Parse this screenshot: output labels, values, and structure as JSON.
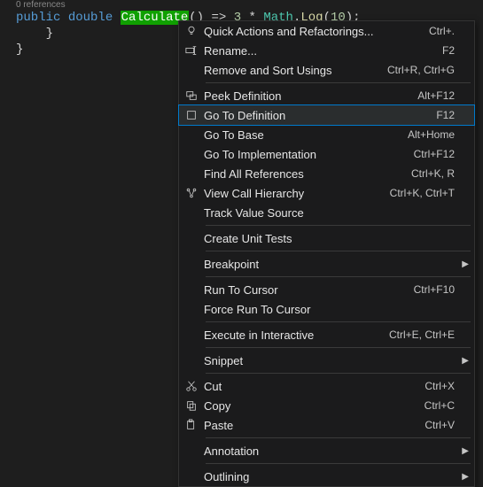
{
  "editor": {
    "codelens": "0 references",
    "tokens": {
      "public": "public",
      "double": "double",
      "method": "Calculate",
      "parens": "()",
      "arrow": " => ",
      "num": "3",
      "star": " * ",
      "class": "Math",
      "dot": ".",
      "member": "Log",
      "open": "(",
      "arg": "10",
      "close": ");"
    },
    "brace1": "    }",
    "brace2": "}"
  },
  "menu": {
    "quick_actions": {
      "label": "Quick Actions and Refactorings...",
      "shortcut": "Ctrl+."
    },
    "rename": {
      "label": "Rename...",
      "shortcut": "F2"
    },
    "remove_usings": {
      "label": "Remove and Sort Usings",
      "shortcut": "Ctrl+R, Ctrl+G"
    },
    "peek_def": {
      "label": "Peek Definition",
      "shortcut": "Alt+F12"
    },
    "goto_def": {
      "label": "Go To Definition",
      "shortcut": "F12"
    },
    "goto_base": {
      "label": "Go To Base",
      "shortcut": "Alt+Home"
    },
    "goto_impl": {
      "label": "Go To Implementation",
      "shortcut": "Ctrl+F12"
    },
    "find_refs": {
      "label": "Find All References",
      "shortcut": "Ctrl+K, R"
    },
    "call_hier": {
      "label": "View Call Hierarchy",
      "shortcut": "Ctrl+K, Ctrl+T"
    },
    "track_value": {
      "label": "Track Value Source",
      "shortcut": ""
    },
    "create_tests": {
      "label": "Create Unit Tests",
      "shortcut": ""
    },
    "breakpoint": {
      "label": "Breakpoint",
      "shortcut": ""
    },
    "run_cursor": {
      "label": "Run To Cursor",
      "shortcut": "Ctrl+F10"
    },
    "force_run": {
      "label": "Force Run To Cursor",
      "shortcut": ""
    },
    "exec_inter": {
      "label": "Execute in Interactive",
      "shortcut": "Ctrl+E, Ctrl+E"
    },
    "snippet": {
      "label": "Snippet",
      "shortcut": ""
    },
    "cut": {
      "label": "Cut",
      "shortcut": "Ctrl+X"
    },
    "copy": {
      "label": "Copy",
      "shortcut": "Ctrl+C"
    },
    "paste": {
      "label": "Paste",
      "shortcut": "Ctrl+V"
    },
    "annotation": {
      "label": "Annotation",
      "shortcut": ""
    },
    "outlining": {
      "label": "Outlining",
      "shortcut": ""
    }
  }
}
